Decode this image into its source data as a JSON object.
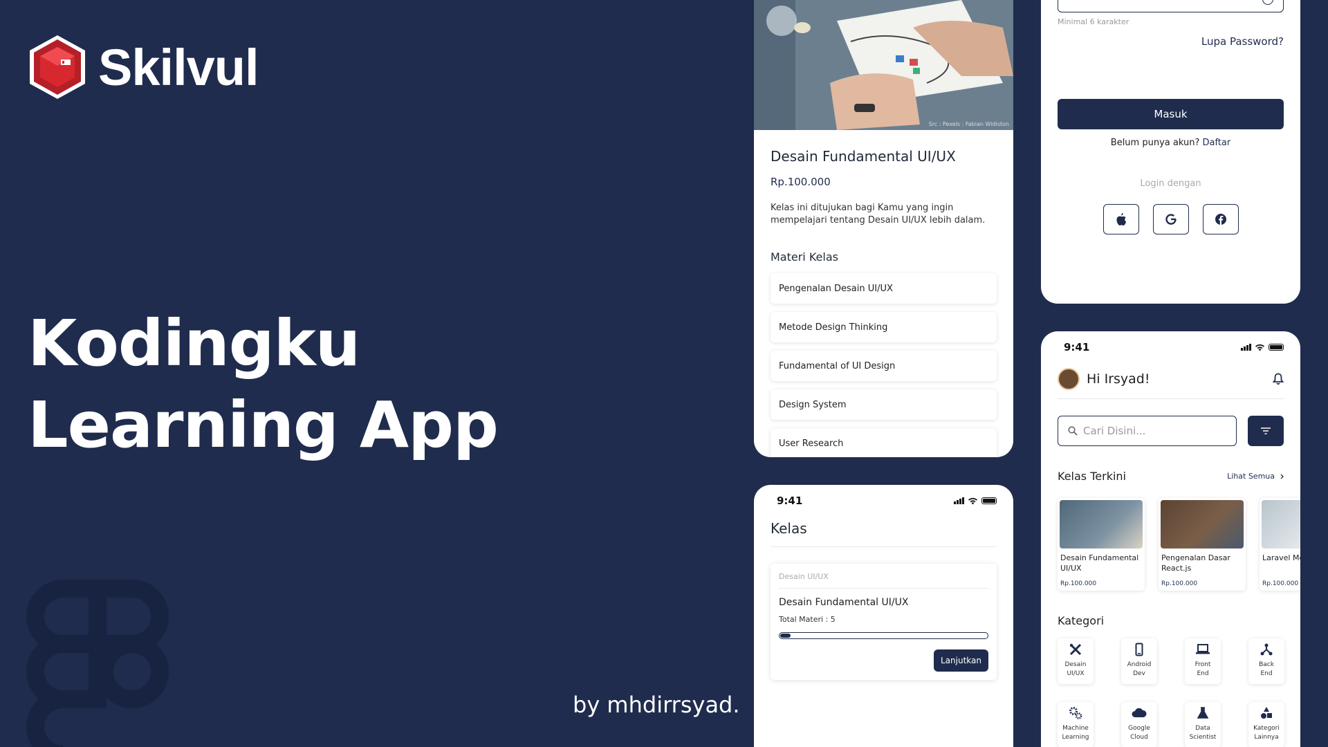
{
  "brand": {
    "name": "Skilvul"
  },
  "hero": {
    "title": "Kodingku Learning App",
    "byline": "by mhdirrsyad."
  },
  "detail": {
    "photo_credit": "Src : Pexels : Fabian Widiston",
    "title": "Desain Fundamental UI/UX",
    "price": "Rp.100.000",
    "description": "Kelas ini ditujukan bagi Kamu yang ingin mempelajari tentang Desain UI/UX lebih dalam.",
    "materi_heading": "Materi Kelas",
    "materi": [
      "Pengenalan Desain UI/UX",
      "Metode Design Thinking",
      "Fundamental of UI Design",
      "Design System",
      "User Research"
    ]
  },
  "login": {
    "password_hint": "Minimal 6 karakter",
    "forgot": "Lupa Password?",
    "submit": "Masuk",
    "register_prompt": "Belum punya akun?",
    "register_link": "Daftar",
    "login_with": "Login dengan",
    "providers": [
      "apple",
      "google",
      "facebook"
    ]
  },
  "kelas": {
    "time": "9:41",
    "title": "Kelas",
    "card": {
      "category": "Desain UI/UX",
      "title": "Desain Fundamental UI/UX",
      "total": "Total Materi : 5",
      "progress": 0.05,
      "button": "Lanjutkan"
    }
  },
  "home": {
    "time": "9:41",
    "greeting": "Hi Irsyad!",
    "search_placeholder": "Cari Disini...",
    "recent_heading": "Kelas Terkini",
    "see_all": "Lihat Semua",
    "courses": [
      {
        "title": "Desain Fundamental UI/UX",
        "price": "Rp.100.000",
        "color": "#4f6878"
      },
      {
        "title": "Pengenalan Dasar React.js",
        "price": "Rp.100.000",
        "color": "#5b4433"
      },
      {
        "title": "Laravel Me",
        "price": "Rp.100.000",
        "color": "#b8c4cc"
      }
    ],
    "category_heading": "Kategori",
    "categories": [
      {
        "label1": "Desain",
        "label2": "UI/UX",
        "icon": "design-tools-icon"
      },
      {
        "label1": "Android",
        "label2": "Dev",
        "icon": "phone-icon"
      },
      {
        "label1": "Front",
        "label2": "End",
        "icon": "laptop-icon"
      },
      {
        "label1": "Back",
        "label2": "End",
        "icon": "network-icon"
      },
      {
        "label1": "Machine",
        "label2": "Learning",
        "icon": "gears-icon"
      },
      {
        "label1": "Google",
        "label2": "Cloud",
        "icon": "cloud-icon"
      },
      {
        "label1": "Data",
        "label2": "Scientist",
        "icon": "flask-icon"
      },
      {
        "label1": "Kategori",
        "label2": "Lainnya",
        "icon": "shapes-icon"
      }
    ]
  },
  "colors": {
    "background": "#1f2c4d",
    "primary": "#1f2c4d",
    "logo_red": "#d7282f"
  }
}
